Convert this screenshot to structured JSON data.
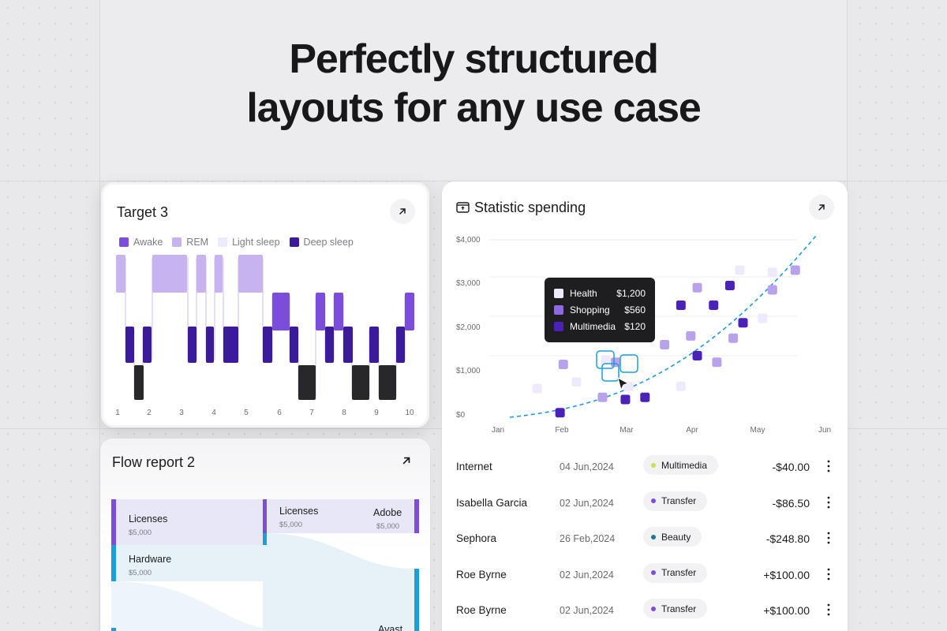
{
  "hero": {
    "line1": "Perfectly structured",
    "line2": "layouts for any use case"
  },
  "colors": {
    "awake": "#7c4ddb",
    "rem": "#c6b3f0",
    "light_sleep": "#efeafb",
    "deep_sleep": "#3c1a9c",
    "black_block": "#28272a",
    "accent_blue": "#1e9bd6",
    "flow_purple": "#7c4ddb",
    "flow_blue": "#1aa0d8"
  },
  "target_card": {
    "title": "Target 3",
    "expand_icon": "arrow-up-right-icon",
    "legend": [
      "Awake",
      "REM",
      "Light sleep",
      "Deep sleep"
    ],
    "x_ticks": [
      "1",
      "2",
      "3",
      "4",
      "5",
      "6",
      "7",
      "8",
      "9",
      "10"
    ]
  },
  "flow_card": {
    "title": "Flow report 2",
    "expand_icon": "arrow-up-right-icon",
    "nodes": [
      {
        "label": "Licenses",
        "value": "$5,000"
      },
      {
        "label": "Hardware",
        "value": "$5,000"
      },
      {
        "label": "Licenses",
        "value": "$5,000"
      },
      {
        "label": "Adobe",
        "value": "$5,000"
      },
      {
        "label": "Avast",
        "value": ""
      }
    ]
  },
  "spending_card": {
    "title": "Statistic spending",
    "title_icon": "wallet-icon",
    "expand_icon": "arrow-up-right-icon",
    "chart_data": {
      "type": "scatter",
      "title": "Statistic spending",
      "xlabel": "",
      "ylabel": "",
      "x_ticks": [
        "Jan",
        "Feb",
        "Mar",
        "Apr",
        "May",
        "Jun"
      ],
      "y_ticks": [
        "$4,000",
        "$3,000",
        "$2,000",
        "$1,000",
        "$0"
      ],
      "ylim": [
        0,
        4000
      ],
      "grid": true,
      "series": [
        {
          "name": "Health",
          "color": "#efeafb",
          "points": [
            [
              0.6,
              600
            ],
            [
              1.2,
              750
            ],
            [
              1.65,
              1250
            ],
            [
              2.0,
              650
            ],
            [
              2.8,
              650
            ],
            [
              3.7,
              3300
            ],
            [
              4.05,
              2200
            ],
            [
              4.2,
              3250
            ]
          ]
        },
        {
          "name": "Shopping",
          "color": "#b9a2ec",
          "points": [
            [
              1.0,
              1150
            ],
            [
              1.8,
              1200
            ],
            [
              1.6,
              400
            ],
            [
              2.55,
              1600
            ],
            [
              2.95,
              1800
            ],
            [
              3.05,
              2900
            ],
            [
              3.35,
              1200
            ],
            [
              3.6,
              1750
            ],
            [
              4.2,
              2850
            ],
            [
              4.55,
              3300
            ]
          ]
        },
        {
          "name": "Multimedia",
          "color": "#4a22b8",
          "points": [
            [
              0.95,
              50
            ],
            [
              1.95,
              350
            ],
            [
              2.25,
              400
            ],
            [
              2.8,
              2500
            ],
            [
              3.05,
              1350
            ],
            [
              3.3,
              2500
            ],
            [
              3.55,
              2950
            ],
            [
              3.75,
              2100
            ]
          ]
        }
      ],
      "trend": {
        "style": "dashed",
        "color": "#1e9bd6"
      }
    },
    "tooltip": [
      {
        "name": "Health",
        "value": "$1,200"
      },
      {
        "name": "Shopping",
        "value": "$560"
      },
      {
        "name": "Multimedia",
        "value": "$120"
      }
    ],
    "transactions": [
      {
        "name": "Internet",
        "date": "04 Jun,2024",
        "category": "Multimedia",
        "dot": "#c5e34a",
        "amount": "-$40.00"
      },
      {
        "name": "Isabella Garcia",
        "date": "02 Jun,2024",
        "category": "Transfer",
        "dot": "#7c4ddb",
        "amount": "-$86.50"
      },
      {
        "name": "Sephora",
        "date": "26 Feb,2024",
        "category": "Beauty",
        "dot": "#18799a",
        "amount": "-$248.80"
      },
      {
        "name": "Roe Byrne",
        "date": "02 Jun,2024",
        "category": "Transfer",
        "dot": "#7c4ddb",
        "amount": "+$100.00"
      },
      {
        "name": "Roe Byrne",
        "date": "02 Jun,2024",
        "category": "Transfer",
        "dot": "#7c4ddb",
        "amount": "+$100.00"
      }
    ],
    "more_icon": "more-vertical-icon"
  }
}
